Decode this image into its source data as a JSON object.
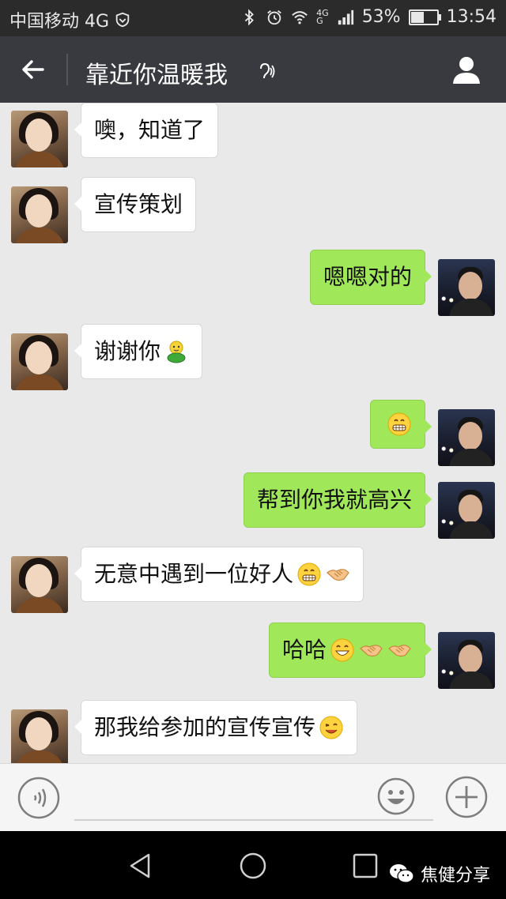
{
  "status_bar": {
    "carrier": "中国移动 4G",
    "network_small_top": "4G",
    "network_small_bottom": "G",
    "battery": "53%",
    "battery_level": 0.53,
    "time": "13:54"
  },
  "header": {
    "title": "靠近你温暖我"
  },
  "messages": [
    {
      "from": "her",
      "text": "噢，知道了",
      "emojis": []
    },
    {
      "from": "her",
      "text": "宣传策划",
      "emojis": []
    },
    {
      "from": "me",
      "text": "嗯嗯对的",
      "emojis": []
    },
    {
      "from": "her",
      "text": "谢谢你",
      "emojis": [
        "doll-emoji"
      ]
    },
    {
      "from": "me",
      "text": "",
      "emojis": [
        "grin-emoji"
      ]
    },
    {
      "from": "me",
      "text": "帮到你我就高兴",
      "emojis": []
    },
    {
      "from": "her",
      "text": "无意中遇到一位好人",
      "emojis": [
        "grin-emoji",
        "handshake-emoji"
      ]
    },
    {
      "from": "me",
      "text": "哈哈",
      "emojis": [
        "laugh-emoji",
        "handshake-emoji",
        "handshake-emoji"
      ]
    },
    {
      "from": "her",
      "text": "那我给参加的宣传宣传",
      "emojis": [
        "wink-emoji"
      ]
    }
  ],
  "input": {
    "value": "",
    "placeholder": ""
  },
  "watermark": {
    "text": "焦健分享"
  },
  "colors": {
    "header_bg": "#393a3f",
    "my_bubble": "#a0e75a",
    "their_bubble": "#ffffff",
    "chat_bg": "#e9e9e9"
  }
}
